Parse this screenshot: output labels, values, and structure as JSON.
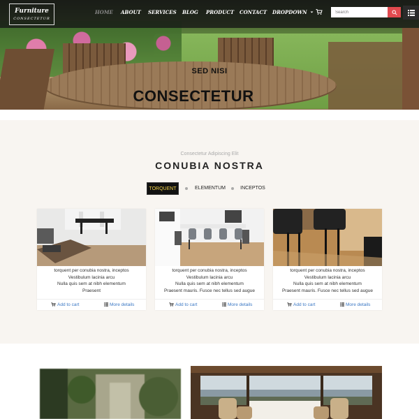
{
  "nav": {
    "logo_line1": "Furniture",
    "logo_line2": "CONSECTETUR",
    "items": [
      "HOME",
      "ABOUT",
      "SERVICES",
      "BLOG",
      "PRODUCT",
      "CONTACT",
      "DROPDOWN"
    ],
    "active_item": "HOME",
    "search_placeholder": "Search",
    "icons": [
      "cart-icon",
      "search-icon",
      "grid-menu-icon",
      "caret-down-icon"
    ],
    "accent_color": "#e14a4f"
  },
  "hero": {
    "subtitle": "SED NISI",
    "title": "CONSECTETUR"
  },
  "section": {
    "kicker": "Consectetur Adipiscing Elit",
    "title": "CONUBIA NOSTRA",
    "tabs": [
      "TORQUENT",
      "ELEMENTUM",
      "INCEPTOS"
    ],
    "active_tab": "TORQUENT",
    "tab_active_text_color": "#f4d44b"
  },
  "cards": [
    {
      "lines": [
        "torquent per conubia nostra, inceptos",
        "Vestibulum lacinia arcu",
        "Nulla quis sem at nibh elementum",
        "Praesent"
      ],
      "add_to_cart": "Add to cart",
      "more_details": "More details"
    },
    {
      "lines": [
        "torquent per conubia nostra, inceptos",
        "Vestibulum lacinia arcu",
        "Nulla quis sem at nibh elementum",
        "Praesent mauris. Fusce nec tellus sed augue"
      ],
      "add_to_cart": "Add to cart",
      "more_details": "More details"
    },
    {
      "lines": [
        "torquent per conubia nostra, inceptos",
        "Vestibulum lacinia arcu",
        "Nulla quis sem at nibh elementum",
        "Praesent mauris. Fusce nec tellus sed augue"
      ],
      "add_to_cart": "Add to cart",
      "more_details": "More details"
    }
  ],
  "link_color": "#3b78c4"
}
